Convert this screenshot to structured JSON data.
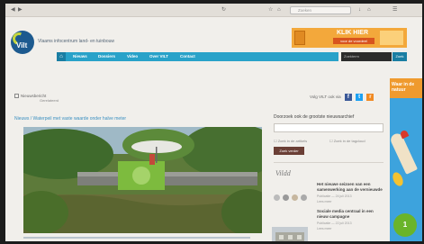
{
  "browser": {
    "search_placeholder": "Zoeken"
  },
  "header": {
    "logo_text": "Vilt",
    "tagline": "Vlaams infocentrum land- en tuinbouw"
  },
  "ad_banner": {
    "headline": "KLIK HIER",
    "sub": "voor de voordeel"
  },
  "nav": {
    "items": [
      "Nieuws",
      "Dossiers",
      "Video",
      "Over VILT",
      "Contact"
    ],
    "search_placeholder": "Zoekterm",
    "search_button": "Zoek"
  },
  "meta": {
    "date": "Nieuwsbericht",
    "tabs": "Gerelateerd"
  },
  "social": {
    "label": "Volg VILT ook via",
    "icons": [
      "facebook-icon",
      "twitter-icon",
      "rss-icon"
    ]
  },
  "breadcrumb": "Nieuws / Waterpeil met vaste waarde onder halve meter",
  "sidebar": {
    "search_title": "Doorzoek ook de grootste nieuwsarchief",
    "check1": "Zoek in de artikels",
    "check2": "Zoek in de tagcloud",
    "button": "Zoek verder",
    "brand": "Vildd",
    "items": [
      {
        "title": "Het nieuwe seizoen van een samenwerking aan de vernieuwde",
        "meta": "Publicatie — 24 juli 2013",
        "meta2": "Lees meer"
      },
      {
        "title": "Sociale media centraal in een nieuw campagne",
        "meta": "Publicatie — 22 juli 2013",
        "meta2": "Lees meer"
      }
    ]
  },
  "sky_ad": {
    "top_text": "Waar in de natuur",
    "badge": "1"
  },
  "colors": {
    "nav": "#29a2c9",
    "ad_orange": "#f3a83b",
    "logo_blue": "#1d5a8f",
    "logo_green": "#c5d63d"
  }
}
